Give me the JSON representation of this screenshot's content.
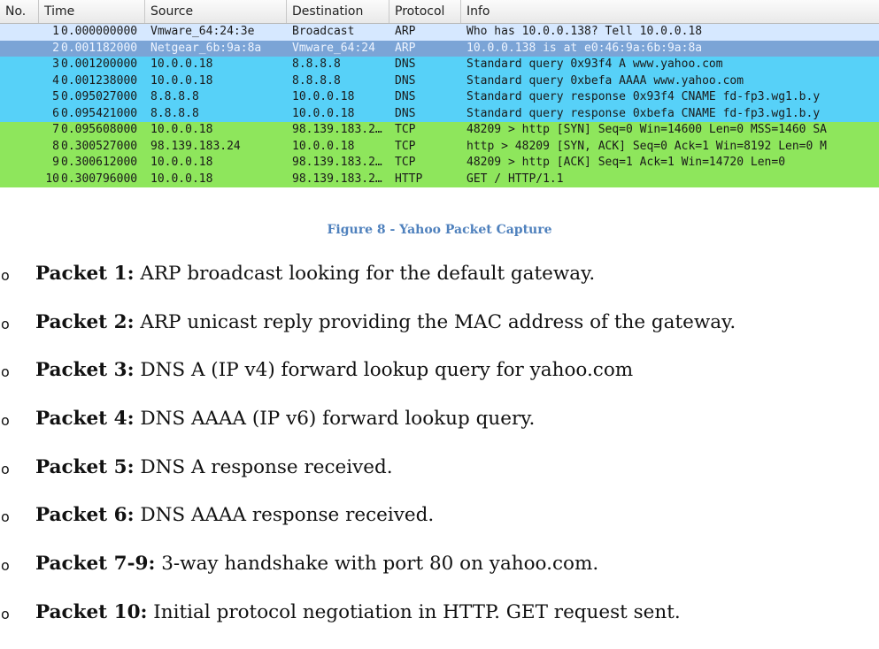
{
  "packet_list": {
    "columns": [
      "No.",
      "Time",
      "Source",
      "Destination",
      "Protocol",
      "Info"
    ],
    "rows": [
      {
        "no": "1",
        "time": "0.000000000",
        "source": "Vmware_64:24:3e",
        "destination": "Broadcast",
        "protocol": "ARP",
        "info": "Who has 10.0.0.138?  Tell 10.0.0.18",
        "bg": "#d6e8ff",
        "fg": "#1a1a1a",
        "selected": false
      },
      {
        "no": "2",
        "time": "0.001182000",
        "source": "Netgear_6b:9a:8a",
        "destination": "Vmware_64:24",
        "protocol": "ARP",
        "info": "10.0.0.138 is at e0:46:9a:6b:9a:8a",
        "bg": "#7ba4d6",
        "fg": "#eef4ff",
        "selected": true
      },
      {
        "no": "3",
        "time": "0.001200000",
        "source": "10.0.0.18",
        "destination": "8.8.8.8",
        "protocol": "DNS",
        "info": "Standard query 0x93f4  A www.yahoo.com",
        "bg": "#57d1f8",
        "fg": "#1a1a1a",
        "selected": false
      },
      {
        "no": "4",
        "time": "0.001238000",
        "source": "10.0.0.18",
        "destination": "8.8.8.8",
        "protocol": "DNS",
        "info": "Standard query 0xbefa  AAAA www.yahoo.com",
        "bg": "#57d1f8",
        "fg": "#1a1a1a",
        "selected": false
      },
      {
        "no": "5",
        "time": "0.095027000",
        "source": "8.8.8.8",
        "destination": "10.0.0.18",
        "protocol": "DNS",
        "info": "Standard query response 0x93f4  CNAME fd-fp3.wg1.b.y",
        "bg": "#57d1f8",
        "fg": "#1a1a1a",
        "selected": false
      },
      {
        "no": "6",
        "time": "0.095421000",
        "source": "8.8.8.8",
        "destination": "10.0.0.18",
        "protocol": "DNS",
        "info": "Standard query response 0xbefa  CNAME fd-fp3.wg1.b.y",
        "bg": "#57d1f8",
        "fg": "#1a1a1a",
        "selected": false
      },
      {
        "no": "7",
        "time": "0.095608000",
        "source": "10.0.0.18",
        "destination": "98.139.183.2…",
        "protocol": "TCP",
        "info": "48209 > http [SYN] Seq=0 Win=14600 Len=0 MSS=1460 SA",
        "bg": "#8ee65c",
        "fg": "#1a1a1a",
        "selected": false
      },
      {
        "no": "8",
        "time": "0.300527000",
        "source": "98.139.183.24",
        "destination": "10.0.0.18",
        "protocol": "TCP",
        "info": "http > 48209 [SYN, ACK] Seq=0 Ack=1 Win=8192 Len=0 M",
        "bg": "#8ee65c",
        "fg": "#1a1a1a",
        "selected": false
      },
      {
        "no": "9",
        "time": "0.300612000",
        "source": "10.0.0.18",
        "destination": "98.139.183.2…",
        "protocol": "TCP",
        "info": "48209 > http [ACK] Seq=1 Ack=1 Win=14720 Len=0",
        "bg": "#8ee65c",
        "fg": "#1a1a1a",
        "selected": false
      },
      {
        "no": "10",
        "time": "0.300796000",
        "source": "10.0.0.18",
        "destination": "98.139.183.2…",
        "protocol": "HTTP",
        "info": "GET / HTTP/1.1",
        "bg": "#8ee65c",
        "fg": "#1a1a1a",
        "selected": false
      }
    ]
  },
  "caption": "Figure 8 - Yahoo Packet Capture",
  "notes": [
    {
      "label": "Packet 1:",
      "text": " ARP broadcast looking for the default gateway."
    },
    {
      "label": "Packet 2:",
      "text": " ARP unicast reply providing the MAC address of the gateway."
    },
    {
      "label": "Packet 3:",
      "text": " DNS A (IP v4) forward lookup query for yahoo.com"
    },
    {
      "label": "Packet 4:",
      "text": " DNS AAAA (IP v6) forward lookup query."
    },
    {
      "label": "Packet 5:",
      "text": " DNS A response received."
    },
    {
      "label": "Packet 6:",
      "text": " DNS AAAA response received."
    },
    {
      "label": "Packet 7-9:",
      "text": " 3-way handshake with port 80 on yahoo.com."
    },
    {
      "label": "Packet 10:",
      "text": " Initial protocol negotiation in HTTP. GET request sent."
    }
  ],
  "bullet_glyph": "o"
}
